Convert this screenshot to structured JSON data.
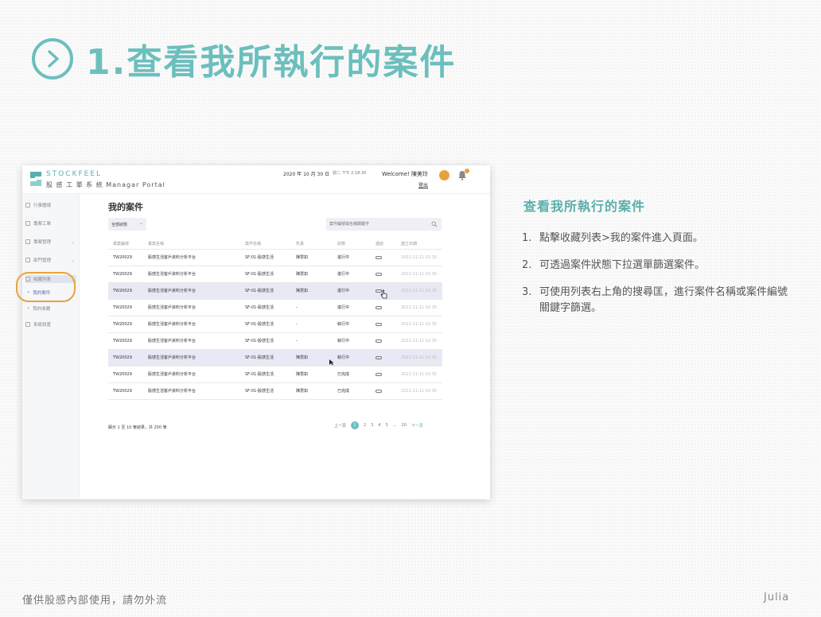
{
  "slide": {
    "title": "1.查看我所執行的案件",
    "description_title": "查看我所執行的案件",
    "steps": [
      {
        "num": "1.",
        "text": "點擊收藏列表>我的案件進入頁面。"
      },
      {
        "num": "2.",
        "text": "可透過案件狀態下拉選單篩選案件。"
      },
      {
        "num": "3.",
        "text": "可使用列表右上角的搜尋匡，進行案件名稱或案件編號關鍵字篩選。"
      }
    ],
    "footer_note": "僅供股感內部使用，請勿外流",
    "author": "Julia"
  },
  "app": {
    "brand": "STOCKFEEL",
    "subtitle": "股 感 工 單 系 統  Managar Portal",
    "date": "2020 年 10 月 30 日",
    "time": "週二 下午 2:18:30",
    "welcome": "Welcome! 陳美玲",
    "logout": "登出",
    "sidebar": {
      "items": [
        {
          "label": "行事曆總",
          "icon": "calendar-icon"
        },
        {
          "label": "專案工單",
          "icon": "tool-icon"
        },
        {
          "label": "專案管理",
          "icon": "folder-icon",
          "chevron": "⌄"
        },
        {
          "label": "部門管理",
          "icon": "people-icon",
          "chevron": "⌄"
        },
        {
          "label": "收藏列表",
          "icon": "star-icon",
          "chevron": "⌄"
        },
        {
          "label": "我的案件",
          "icon": "dot-icon"
        },
        {
          "label": "我的收藏",
          "icon": "dot-icon"
        },
        {
          "label": "系統設置",
          "icon": "settings-icon"
        }
      ]
    },
    "page_title": "我的案件",
    "status_filter": "全部狀態",
    "search_placeholder": "案件編號或名稱關鍵字",
    "table": {
      "headers": [
        "專案編號",
        "專案名稱",
        "案件名稱",
        "負責",
        "狀態",
        "連結",
        "建立日期"
      ],
      "rows": [
        [
          "TW20029",
          "股感生活客戶資料分析平台",
          "SF-01-股感生活",
          "陳慧如",
          "進行中",
          "",
          "2021-11-11 02:35"
        ],
        [
          "TW20029",
          "股感生活客戶資料分析平台",
          "SF-01-股感生活",
          "陳慧如",
          "進行中",
          "",
          "2021-11-11 02:35"
        ],
        [
          "TW20029",
          "股感生活客戶資料分析平台",
          "SF-01-股感生活",
          "陳慧如",
          "進行中",
          "",
          "2021-11-11 02:35"
        ],
        [
          "TW20029",
          "股感生活客戶資料分析平台",
          "SF-01-股感生活",
          "-",
          "進行中",
          "",
          "2021-11-11 02:35"
        ],
        [
          "TW20029",
          "股感生活客戶資料分析平台",
          "SF-01-股感生活",
          "-",
          "執行中",
          "",
          "2021-11-11 02:35"
        ],
        [
          "TW20029",
          "股感生活客戶資料分析平台",
          "SF-01-股感生活",
          "-",
          "執行中",
          "",
          "2021-11-11 02:35"
        ],
        [
          "TW20029",
          "股感生活客戶資料分析平台",
          "SF-01-股感生活",
          "陳慧如",
          "執行中",
          "",
          "2021-11-11 02:35"
        ],
        [
          "TW20029",
          "股感生活客戶資料分析平台",
          "SF-01-股感生活",
          "陳慧如",
          "已完成",
          "",
          "2021-11-11 02:35"
        ],
        [
          "TW20029",
          "股感生活客戶資料分析平台",
          "SF-01-股感生活",
          "陳慧如",
          "已完成",
          "",
          "2021-11-11 02:35"
        ]
      ],
      "highlighted_rows": [
        2,
        6
      ]
    },
    "footer_count": "顯示 1 至 10 筆結果，共 200 筆",
    "pagination": {
      "prev": "上一頁",
      "pages": [
        "1",
        "2",
        "3",
        "4",
        "5",
        "...",
        "20"
      ],
      "active": "1",
      "next": "下一頁"
    }
  },
  "colors": {
    "accent": "#6cbfbd",
    "highlight": "#e8a23c"
  }
}
